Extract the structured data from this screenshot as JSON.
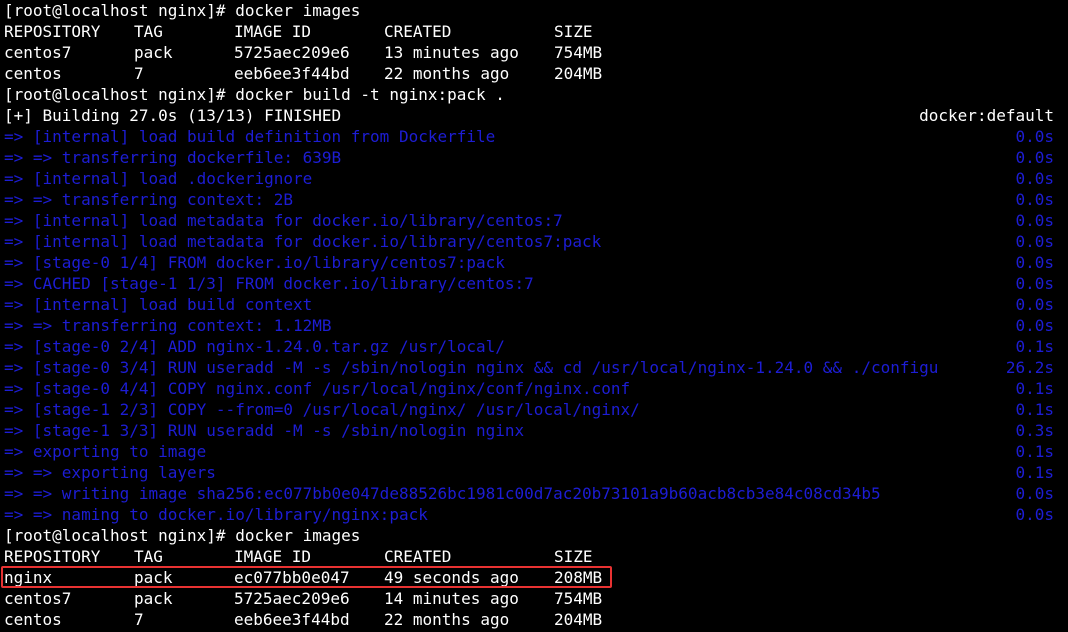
{
  "terminal": {
    "prompt": "[root@localhost nginx]# ",
    "commands": [
      "docker images",
      "docker build -t nginx:pack .",
      "docker images"
    ],
    "headers": [
      "REPOSITORY",
      "TAG",
      "IMAGE ID",
      "CREATED",
      "SIZE"
    ],
    "images_before": [
      [
        "centos7",
        "pack",
        "5725aec209e6",
        "13 minutes ago",
        "754MB"
      ],
      [
        "centos",
        "7",
        "eeb6ee3f44bd",
        "22 months ago",
        "204MB"
      ]
    ],
    "build_status": "[+] Building 27.0s (13/13) FINISHED",
    "build_context": "docker:default",
    "build_steps": [
      {
        "text": "=> [internal] load build definition from Dockerfile",
        "time": "0.0s"
      },
      {
        "text": "=> => transferring dockerfile: 639B",
        "time": "0.0s"
      },
      {
        "text": "=> [internal] load .dockerignore",
        "time": "0.0s"
      },
      {
        "text": "=> => transferring context: 2B",
        "time": "0.0s"
      },
      {
        "text": "=> [internal] load metadata for docker.io/library/centos:7",
        "time": "0.0s"
      },
      {
        "text": "=> [internal] load metadata for docker.io/library/centos7:pack",
        "time": "0.0s"
      },
      {
        "text": "=> [stage-0 1/4] FROM docker.io/library/centos7:pack",
        "time": "0.0s"
      },
      {
        "text": "=> CACHED [stage-1 1/3] FROM docker.io/library/centos:7",
        "time": "0.0s"
      },
      {
        "text": "=> [internal] load build context",
        "time": "0.0s"
      },
      {
        "text": "=> => transferring context: 1.12MB",
        "time": "0.0s"
      },
      {
        "text": "=> [stage-0 2/4] ADD nginx-1.24.0.tar.gz /usr/local/",
        "time": "0.1s"
      },
      {
        "text": "=> [stage-0 3/4] RUN useradd -M -s /sbin/nologin nginx && cd /usr/local/nginx-1.24.0 && ./configu",
        "time": "26.2s"
      },
      {
        "text": "=> [stage-0 4/4] COPY nginx.conf /usr/local/nginx/conf/nginx.conf",
        "time": "0.1s"
      },
      {
        "text": "=> [stage-1 2/3] COPY --from=0 /usr/local/nginx/ /usr/local/nginx/",
        "time": "0.1s"
      },
      {
        "text": "=> [stage-1 3/3] RUN useradd -M -s /sbin/nologin nginx",
        "time": "0.3s"
      },
      {
        "text": "=> exporting to image",
        "time": "0.1s"
      },
      {
        "text": "=> => exporting layers",
        "time": "0.1s"
      },
      {
        "text": "=> => writing image sha256:ec077bb0e047de88526bc1981c00d7ac20b73101a9b60acb8cb3e84c08cd34b5",
        "time": "0.0s"
      },
      {
        "text": "=> => naming to docker.io/library/nginx:pack",
        "time": "0.0s"
      }
    ],
    "images_after": [
      [
        "nginx",
        "pack",
        "ec077bb0e047",
        "49 seconds ago",
        "208MB"
      ],
      [
        "centos7",
        "pack",
        "5725aec209e6",
        "14 minutes ago",
        "754MB"
      ],
      [
        "centos",
        "7",
        "eeb6ee3f44bd",
        "22 months ago",
        "204MB"
      ]
    ],
    "colors": {
      "background": "#000000",
      "text": "#ffffff",
      "build_step": "#1d1dd4",
      "highlight_border": "#e83232"
    }
  }
}
